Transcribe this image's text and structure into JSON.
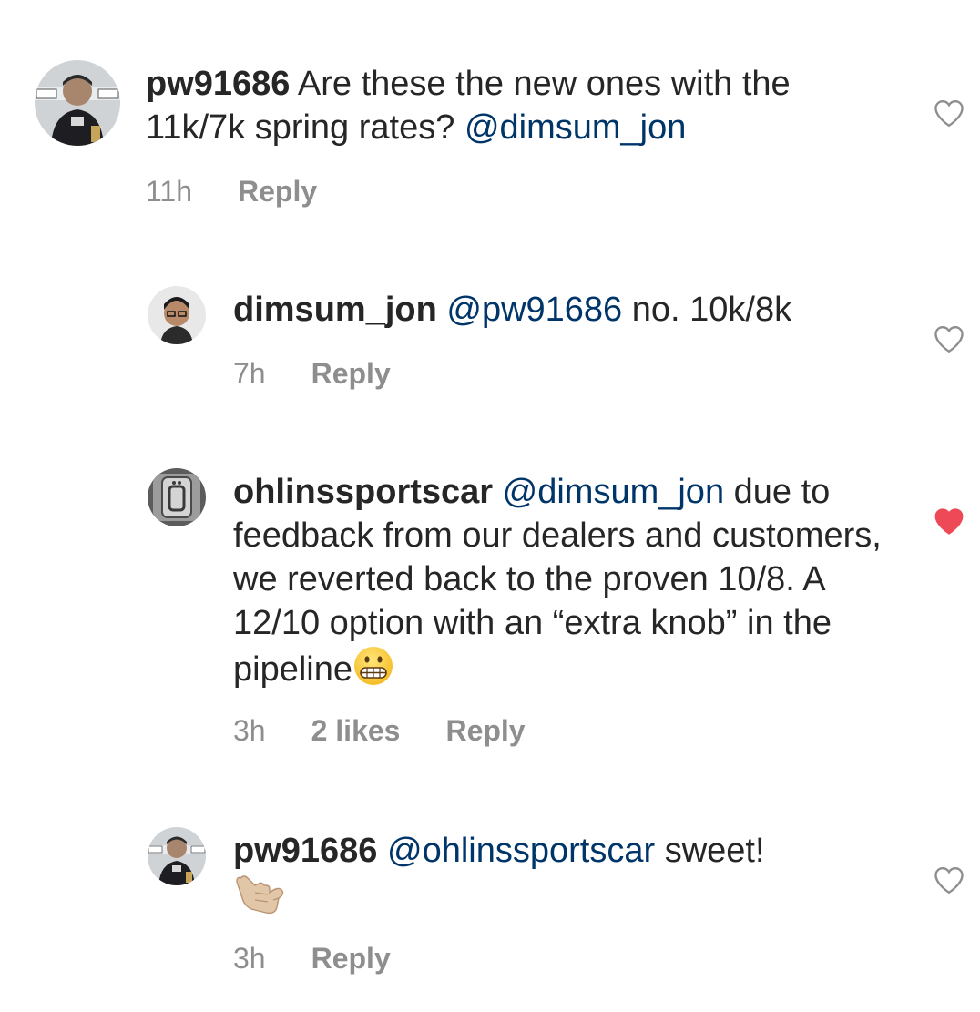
{
  "comments": [
    {
      "username": "pw91686",
      "text": " Are these the new ones with the 11k/7k spring rates? ",
      "mention": "@dimsum_jon",
      "time": "11h",
      "reply_label": "Reply",
      "liked": false
    },
    {
      "username": "dimsum_jon",
      "mention": "@pw91686",
      "text": " no. 10k/8k",
      "time": "7h",
      "reply_label": "Reply",
      "liked": false
    },
    {
      "username": "ohlinssportscar",
      "mention": "@dimsum_jon",
      "text": " due to feedback from our dealers and customers, we reverted back to the proven 10/8. A 12/10 option with an “extra knob” in the pipeline",
      "emoji": "grimacing-face",
      "time": "3h",
      "likes": "2 likes",
      "reply_label": "Reply",
      "liked": true
    },
    {
      "username": "pw91686",
      "mention": "@ohlinssportscar",
      "text": " sweet!",
      "emoji": "call-me-hand",
      "time": "3h",
      "reply_label": "Reply",
      "liked": false
    }
  ],
  "colors": {
    "text": "#262626",
    "mention": "#003569",
    "meta": "#8e8e8e",
    "heart_liked": "#ed4956"
  }
}
